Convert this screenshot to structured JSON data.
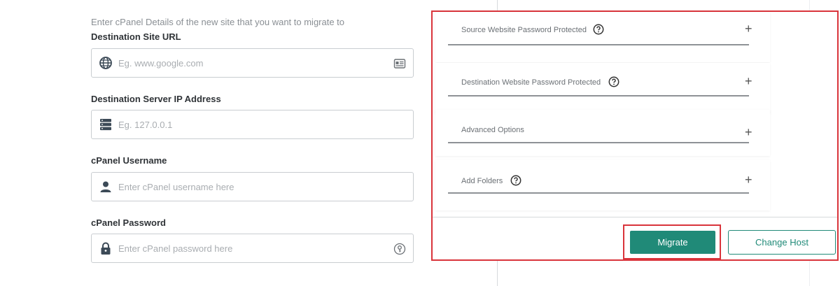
{
  "form": {
    "intro": "Enter cPanel Details of the new site that you want to migrate to",
    "destination_url": {
      "label": "Destination Site URL",
      "placeholder": "Eg. www.google.com",
      "value": "",
      "lead_icon": "globe-icon",
      "trail_icon": "id-card-icon"
    },
    "server_ip": {
      "label": "Destination Server IP Address",
      "placeholder": "Eg. 127.0.0.1",
      "value": "",
      "lead_icon": "server-icon"
    },
    "cpanel_username": {
      "label": "cPanel Username",
      "placeholder": "Enter cPanel username here",
      "value": "",
      "lead_icon": "user-icon"
    },
    "cpanel_password": {
      "label": "cPanel Password",
      "placeholder": "Enter cPanel password here",
      "value": "",
      "lead_icon": "lock-icon",
      "trail_icon": "key-icon"
    }
  },
  "accordion": {
    "items": [
      {
        "label": "Source Website Password Protected",
        "has_help": true,
        "expand_symbol": "+"
      },
      {
        "label": "Destination Website Password Protected",
        "has_help": true,
        "expand_symbol": "+"
      },
      {
        "label": "Advanced Options",
        "has_help": false,
        "expand_symbol": "+"
      },
      {
        "label": "Add Folders",
        "has_help": true,
        "expand_symbol": "+"
      }
    ]
  },
  "actions": {
    "migrate_label": "Migrate",
    "change_host_label": "Change Host"
  },
  "colors": {
    "accent": "#208a78",
    "highlight": "#d9343b",
    "icon": "#3c4a57"
  }
}
